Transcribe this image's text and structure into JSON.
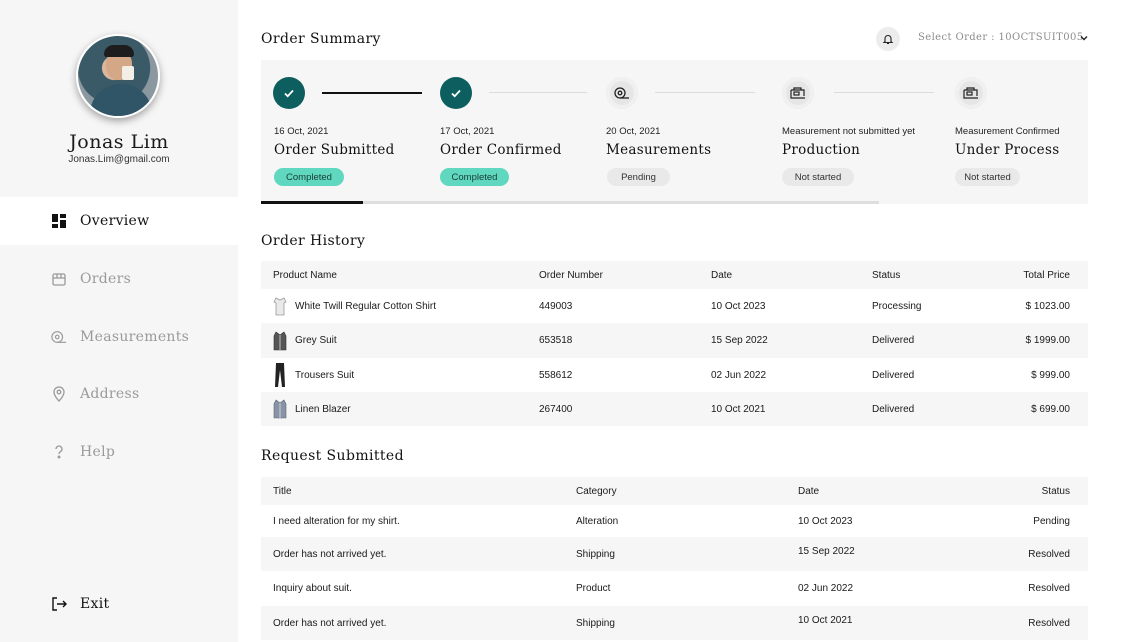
{
  "user": {
    "name": "Jonas Lim",
    "email": "Jonas.Lim@gmail.com"
  },
  "nav": [
    {
      "label": "Overview",
      "icon": "dashboard-icon",
      "active": true
    },
    {
      "label": "Orders",
      "icon": "box-icon",
      "active": false
    },
    {
      "label": "Measurements",
      "icon": "measuring-tape-icon",
      "active": false
    },
    {
      "label": "Address",
      "icon": "location-pin-icon",
      "active": false
    },
    {
      "label": "Help",
      "icon": "question-icon",
      "active": false
    }
  ],
  "exit_label": "Exit",
  "summary": {
    "title": "Order Summary",
    "select_order": "Select Order : 10OCTSUIT005",
    "progress_fraction": 0.165,
    "steps": [
      {
        "date": "16 Oct, 2021",
        "name": "Order Submitted",
        "status": "Completed",
        "done": true,
        "icon": "check-icon"
      },
      {
        "date": "17 Oct, 2021",
        "name": "Order Confirmed",
        "status": "Completed",
        "done": true,
        "icon": "check-icon"
      },
      {
        "date": "20 Oct, 2021",
        "name": "Measurements",
        "status": "Pending",
        "done": false,
        "icon": "measuring-tape-icon"
      },
      {
        "date": "Measurement not submitted yet",
        "name": "Production",
        "status": "Not started",
        "done": false,
        "icon": "sewing-machine-icon"
      },
      {
        "date": "Measurement Confirmed",
        "name": "Under Process",
        "status": "Not started",
        "done": false,
        "icon": "sewing-machine-icon"
      }
    ]
  },
  "order_history": {
    "title": "Order History",
    "columns": [
      "Product Name",
      "Order Number",
      "Date",
      "Status",
      "Total Price"
    ],
    "rows": [
      {
        "product": "White Twill Regular Cotton Shirt",
        "icon": "shirt-icon",
        "number": "449003",
        "date": "10 Oct 2023",
        "status": "Processing",
        "price": "$ 1023.00"
      },
      {
        "product": "Grey Suit",
        "icon": "suit-icon",
        "number": "653518",
        "date": "15 Sep 2022",
        "status": "Delivered",
        "price": "$ 1999.00"
      },
      {
        "product": "Trousers Suit",
        "icon": "trousers-icon",
        "number": "558612",
        "date": "02 Jun 2022",
        "status": "Delivered",
        "price": "$ 999.00"
      },
      {
        "product": "Linen Blazer",
        "icon": "blazer-icon",
        "number": "267400",
        "date": "10 Oct 2021",
        "status": "Delivered",
        "price": "$ 699.00"
      }
    ]
  },
  "requests": {
    "title": "Request Submitted",
    "columns": [
      "Title",
      "Category",
      "Date",
      "Status"
    ],
    "rows": [
      {
        "title": "I need alteration for my shirt.",
        "category": "Alteration",
        "date": "10 Oct 2023",
        "status": "Pending"
      },
      {
        "title": "Order has not arrived yet.",
        "category": "Shipping",
        "date": "15 Sep 2022",
        "status": "Resolved"
      },
      {
        "title": "Inquiry about suit.",
        "category": "Product",
        "date": "02 Jun 2022",
        "status": "Resolved"
      },
      {
        "title": "Order has not arrived yet.",
        "category": "Shipping",
        "date": "10 Oct 2021",
        "status": "Resolved"
      }
    ]
  },
  "colors": {
    "accent": "#0d5f5f",
    "completed_badge": "#5fd8bf",
    "panel": "#f6f6f6"
  }
}
